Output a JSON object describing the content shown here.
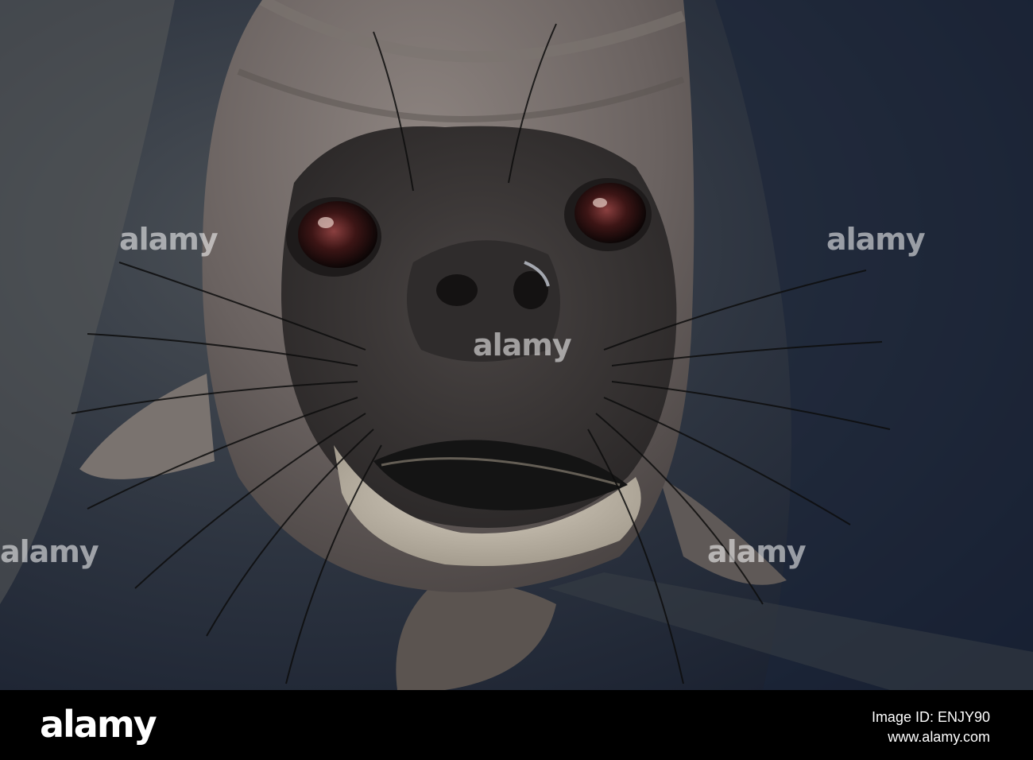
{
  "image": {
    "subject": "seal-pup-face",
    "watermark_text": "alamy"
  },
  "footer": {
    "logo_text": "alamy",
    "image_id_label": "Image ID: ENJY90",
    "website": "www.alamy.com"
  },
  "colors": {
    "background": "#000000",
    "sand": "#2e3540",
    "fur": "#6b6461",
    "face": "#3e3a39",
    "chin": "#bfb7a8"
  }
}
